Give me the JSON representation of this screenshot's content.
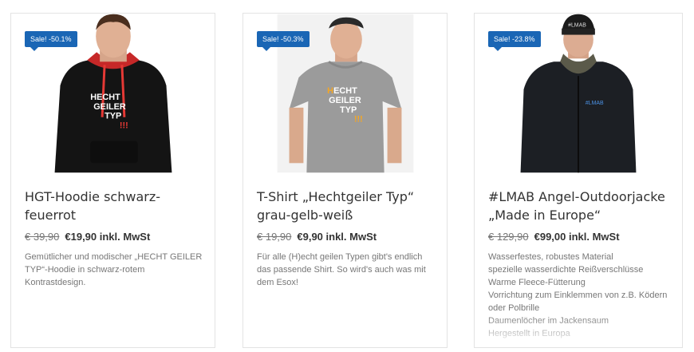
{
  "products": [
    {
      "badge": "Sale! -50.1%",
      "title": "HGT-Hoodie schwarz-feuerrot",
      "old_price": "€ 39,90",
      "new_price": "€19,90 inkl. MwSt",
      "description": "Gemütlicher und modischer „HECHT GEILER TYP“-Hoodie in schwarz-rotem Kontrastdesign.",
      "print": [
        "HECHT",
        "GEILER",
        "TYP",
        "!!!"
      ]
    },
    {
      "badge": "Sale! -50.3%",
      "title": "T-Shirt „Hechtgeiler Typ“ grau-gelb-weiß",
      "old_price": "€ 19,90",
      "new_price": "€9,90 inkl. MwSt",
      "description": "Für alle (H)echt geilen Typen gibt's endlich das passende Shirt. So wird's auch was mit dem Esox!",
      "print": [
        "HECHT",
        "GEILER",
        "TYP",
        "!!!"
      ]
    },
    {
      "badge": "Sale! -23.8%",
      "title": "#LMAB Angel-Outdoorjacke „Made in Europe“",
      "old_price": "€ 129,90",
      "new_price": "€99,00 inkl. MwSt",
      "description_lines": [
        "Wasserfestes, robustes Material",
        "spezielle wasserdichte Reißverschlüsse",
        "Warme Fleece-Fütterung",
        "Vorrichtung zum Einklemmen von z.B. Ködern oder Polbrille",
        "Daumenlöcher im Jackensaum",
        "Hergestellt in Europa"
      ],
      "print": [
        "#LMAB"
      ]
    }
  ],
  "colors": {
    "badge": "#1a66b5",
    "accent_red": "#e53935",
    "accent_yellow": "#f5a623"
  }
}
